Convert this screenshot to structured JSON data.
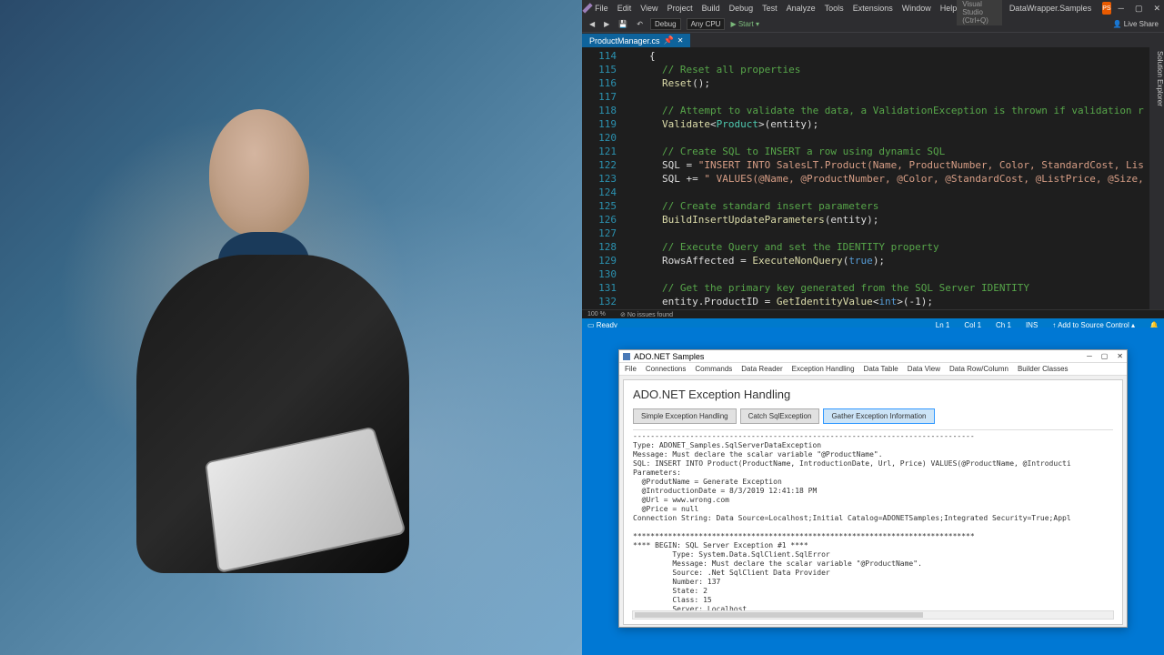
{
  "vs": {
    "menu": [
      "File",
      "Edit",
      "View",
      "Project",
      "Build",
      "Debug",
      "Test",
      "Analyze",
      "Tools",
      "Extensions",
      "Window",
      "Help"
    ],
    "search_placeholder": "Search Visual Studio (Ctrl+Q)",
    "solution": "DataWrapper.Samples",
    "user_initials": "PS",
    "toolbar": {
      "config": "Debug",
      "platform": "Any CPU",
      "start": "Start",
      "liveshare": "Live Share"
    },
    "tab": "ProductManager.cs",
    "sidebar_label": "Solution Explorer",
    "zoom": "100 %",
    "no_issues": "No issues found",
    "status": {
      "ready": "Ready",
      "ln": "Ln 1",
      "col": "Col 1",
      "ch": "Ch 1",
      "ins": "INS",
      "source_control": "Add to Source Control"
    },
    "code_start_line": 114,
    "lines": [
      {
        "indent": 2,
        "t": [
          [
            "",
            "{"
          ]
        ]
      },
      {
        "indent": 3,
        "t": [
          [
            "c-com",
            "// Reset all properties"
          ]
        ]
      },
      {
        "indent": 3,
        "t": [
          [
            "c-call",
            "Reset"
          ],
          [
            "",
            "();"
          ]
        ]
      },
      {
        "indent": 3,
        "t": []
      },
      {
        "indent": 3,
        "t": [
          [
            "c-com",
            "// Attempt to validate the data, a ValidationException is thrown if validation r"
          ]
        ]
      },
      {
        "indent": 3,
        "t": [
          [
            "c-call",
            "Validate"
          ],
          [
            "",
            "<"
          ],
          [
            "c-type",
            "Product"
          ],
          [
            "",
            ">(entity);"
          ]
        ]
      },
      {
        "indent": 3,
        "t": []
      },
      {
        "indent": 3,
        "t": [
          [
            "c-com",
            "// Create SQL to INSERT a row using dynamic SQL"
          ]
        ]
      },
      {
        "indent": 3,
        "t": [
          [
            "",
            "SQL = "
          ],
          [
            "c-str",
            "\"INSERT INTO SalesLT.Product(Name, ProductNumber, Color, StandardCost, Lis"
          ]
        ]
      },
      {
        "indent": 3,
        "t": [
          [
            "",
            "SQL += "
          ],
          [
            "c-str",
            "\" VALUES(@Name, @ProductNumber, @Color, @StandardCost, @ListPrice, @Size,"
          ]
        ]
      },
      {
        "indent": 3,
        "t": []
      },
      {
        "indent": 3,
        "t": [
          [
            "c-com",
            "// Create standard insert parameters"
          ]
        ]
      },
      {
        "indent": 3,
        "t": [
          [
            "c-call",
            "BuildInsertUpdateParameters"
          ],
          [
            "",
            "(entity);"
          ]
        ]
      },
      {
        "indent": 3,
        "t": []
      },
      {
        "indent": 3,
        "t": [
          [
            "c-com",
            "// Execute Query and set the IDENTITY property"
          ]
        ]
      },
      {
        "indent": 3,
        "t": [
          [
            "",
            "RowsAffected = "
          ],
          [
            "c-call",
            "ExecuteNonQuery"
          ],
          [
            "",
            "("
          ],
          [
            "c-kw",
            "true"
          ],
          [
            "",
            ");"
          ]
        ]
      },
      {
        "indent": 3,
        "t": []
      },
      {
        "indent": 3,
        "t": [
          [
            "c-com",
            "// Get the primary key generated from the SQL Server IDENTITY"
          ]
        ]
      },
      {
        "indent": 3,
        "t": [
          [
            "",
            "entity.ProductID = "
          ],
          [
            "c-call",
            "GetIdentityValue"
          ],
          [
            "",
            "<"
          ],
          [
            "c-kw",
            "int"
          ],
          [
            "",
            ">(-1);"
          ]
        ]
      }
    ]
  },
  "app": {
    "title": "ADO.NET Samples",
    "menu": [
      "File",
      "Connections",
      "Commands",
      "Data Reader",
      "Exception Handling",
      "Data Table",
      "Data View",
      "Data Row/Column",
      "Builder Classes"
    ],
    "heading": "ADO.NET Exception Handling",
    "buttons": [
      {
        "label": "Simple Exception Handling",
        "active": false
      },
      {
        "label": "Catch SqlException",
        "active": false
      },
      {
        "label": "Gather Exception Information",
        "active": true
      }
    ],
    "output": "------------------------------------------------------------------------------\nType: ADONET_Samples.SqlServerDataException\nMessage: Must declare the scalar variable \"@ProductName\".\nSQL: INSERT INTO Product(ProductName, IntroductionDate, Url, Price) VALUES(@ProductName, @Introducti\nParameters:\n  @ProdutName = Generate Exception\n  @IntroductionDate = 8/3/2019 12:41:18 PM\n  @Url = www.wrong.com\n  @Price = null\nConnection String: Data Source=Localhost;Initial Catalog=ADONETSamples;Integrated Security=True;Appl\n\n******************************************************************************\n**** BEGIN: SQL Server Exception #1 ****\n         Type: System.Data.SqlClient.SqlError\n         Message: Must declare the scalar variable \"@ProductName\".\n         Source: .Net SqlClient Data Provider\n         Number: 137\n         State: 2\n         Class: 15\n         Server: Localhost"
  }
}
